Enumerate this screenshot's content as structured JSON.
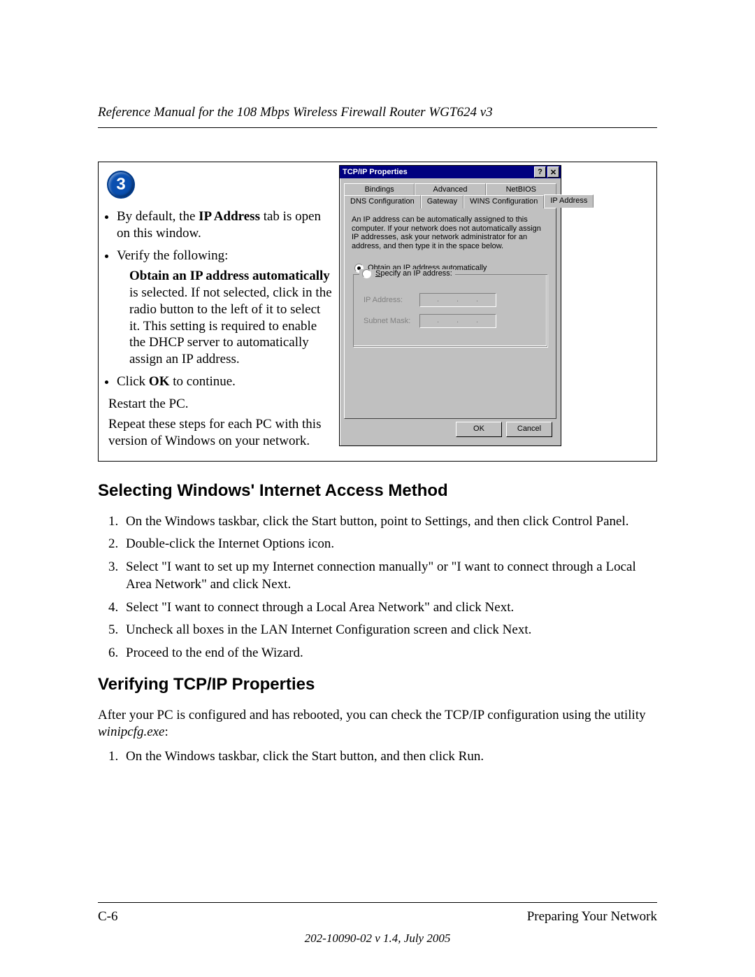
{
  "header": {
    "running_title": "Reference Manual for the 108 Mbps Wireless Firewall Router WGT624 v3"
  },
  "step": {
    "number": "3",
    "bullets": {
      "b1_pre": "By default, the ",
      "b1_bold": "IP Address",
      "b1_post": " tab is open on this window.",
      "b2": "Verify the following:",
      "b2_sub_bold": "Obtain an IP address automatically",
      "b2_sub_rest": " is selected. If not selected, click in the radio button to the left of it to select it.  This setting is required to enable the DHCP server to automatically assign an IP address.",
      "b3_pre": "Click ",
      "b3_bold": "OK",
      "b3_post": " to continue."
    },
    "p1": "Restart the PC.",
    "p2": "Repeat these steps for each PC with this version of Windows on your network."
  },
  "dialog": {
    "title": "TCP/IP Properties",
    "help_btn": "?",
    "close_btn": "✕",
    "tabs_row1": {
      "t1": "Bindings",
      "t2": "Advanced",
      "t3": "NetBIOS"
    },
    "tabs_row2": {
      "t1": "DNS Configuration",
      "t2": "Gateway",
      "t3": "WINS Configuration",
      "t4": "IP Address"
    },
    "help_text": "An IP address can be automatically assigned to this computer. If your network does not automatically assign IP addresses, ask your network administrator for an address, and then type it in the space below.",
    "radio_auto": "Obtain an IP address automatically",
    "radio_specify": "Specify an IP address:",
    "field_ip": "IP Address:",
    "field_mask": "Subnet Mask:",
    "ok": "OK",
    "cancel": "Cancel"
  },
  "section1": {
    "heading": "Selecting Windows' Internet Access Method",
    "items": {
      "i1": "On the Windows taskbar, click the Start button, point to Settings, and then click Control Panel.",
      "i2": "Double-click the Internet Options icon.",
      "i3": "Select \"I want to set up my Internet connection manually\" or \"I want to connect through a Local Area Network\" and click Next.",
      "i4": "Select \"I want to connect through a Local Area Network\" and click Next.",
      "i5": "Uncheck all boxes in the LAN Internet Configuration screen and click Next.",
      "i6": "Proceed to the end of the Wizard."
    }
  },
  "section2": {
    "heading": "Verifying TCP/IP Properties",
    "intro_pre": "After your PC is configured and has rebooted, you can check the TCP/IP configuration using the utility ",
    "intro_em": "winipcfg.exe",
    "intro_post": ":",
    "items": {
      "i1": "On the Windows taskbar, click the Start button, and then click Run."
    }
  },
  "footer": {
    "left": "C-6",
    "right": "Preparing Your Network",
    "center": "202-10090-02 v 1.4, July 2005"
  }
}
